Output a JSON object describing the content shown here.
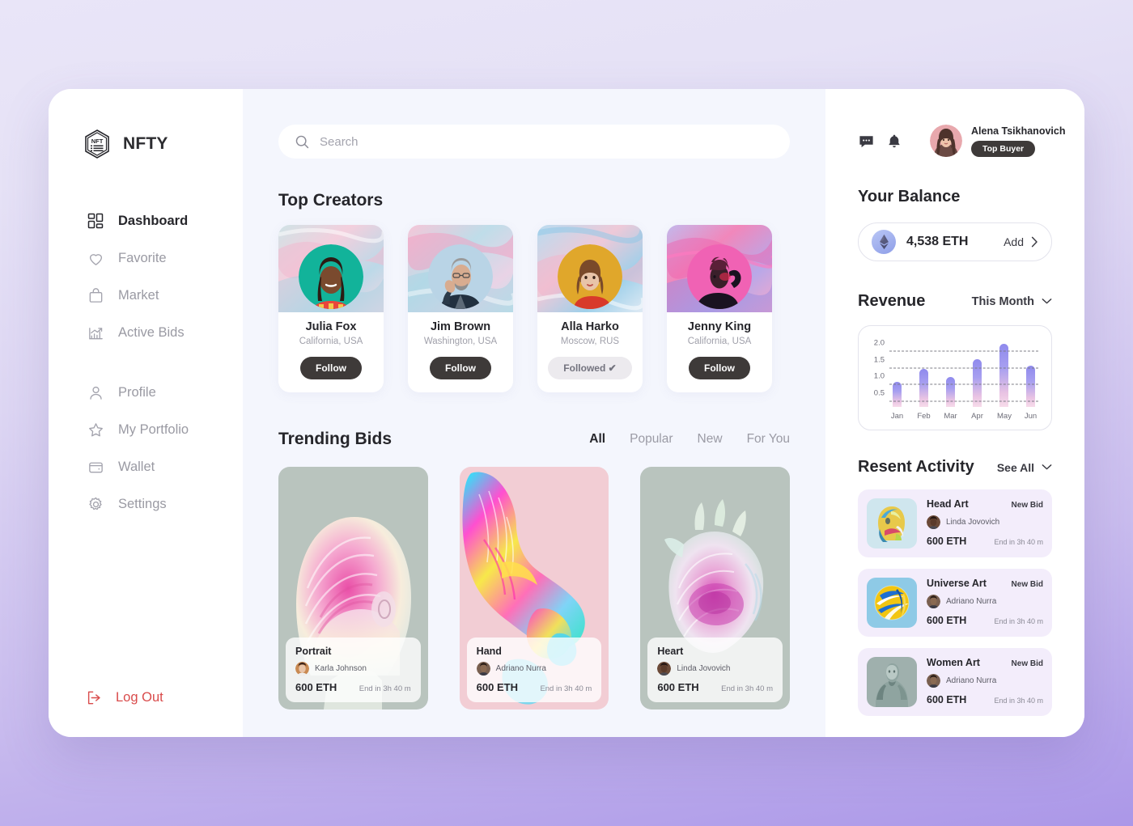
{
  "brand": {
    "name": "NFTY",
    "logo_icon": "nft-hexagon-logo-icon"
  },
  "sidebar": {
    "groups": [
      {
        "items": [
          {
            "label": "Dashboard",
            "icon": "grid-icon",
            "active": true
          },
          {
            "label": "Favorite",
            "icon": "heart-icon",
            "active": false
          },
          {
            "label": "Market",
            "icon": "bag-icon",
            "active": false
          },
          {
            "label": "Active Bids",
            "icon": "chart-up-icon",
            "active": false
          }
        ]
      },
      {
        "items": [
          {
            "label": "Profile",
            "icon": "user-icon",
            "active": false
          },
          {
            "label": "My Portfolio",
            "icon": "star-icon",
            "active": false
          },
          {
            "label": "Wallet",
            "icon": "wallet-icon",
            "active": false
          },
          {
            "label": "Settings",
            "icon": "gear-icon",
            "active": false
          }
        ]
      }
    ],
    "logout": {
      "label": "Log Out",
      "icon": "logout-arrow-icon",
      "color": "#d94b4b"
    }
  },
  "search": {
    "placeholder": "Search",
    "value": "",
    "icon": "search-icon"
  },
  "top_creators": {
    "title": "Top Creators",
    "cards": [
      {
        "name": "Julia Fox",
        "location": "California, USA",
        "button": "Follow",
        "followed": false,
        "cover": [
          "#cfe3e6",
          "#f3cfdd",
          "#bcd9e8",
          "#f0d7e4"
        ],
        "avatar": [
          "#12b39a",
          "#0ea58f"
        ],
        "skin": "#7a4a2e",
        "hair": "#2b1c14",
        "shirt": "#e8453c"
      },
      {
        "name": "Jim Brown",
        "location": "Washington, USA",
        "button": "Follow",
        "followed": false,
        "cover": [
          "#f5c6d8",
          "#bfdde9",
          "#e9d3e6",
          "#c9e2ea"
        ],
        "avatar": [
          "#b9d4e6",
          "#a5c7de"
        ],
        "skin": "#d8ac90",
        "hair": "#9a9a9a",
        "shirt": "#22303f"
      },
      {
        "name": "Alla Harko",
        "location": "Moscow, RUS",
        "button": "Followed",
        "followed": true,
        "cover": [
          "#b9dcf0",
          "#eec9d8",
          "#9fd0ea",
          "#dfeaf4"
        ],
        "avatar": [
          "#e0a72b",
          "#cf9520"
        ],
        "skin": "#e8c4a8",
        "hair": "#7a4a2a",
        "shirt": "#d83a2a"
      },
      {
        "name": "Jenny King",
        "location": "California, USA",
        "button": "Follow",
        "followed": false,
        "cover": [
          "#c3b8ec",
          "#f187bb",
          "#b9a8e8",
          "#f5a7cc"
        ],
        "avatar": [
          "#f062b4",
          "#e8479f"
        ],
        "skin": "#3a1f2a",
        "hair": "#5a2038",
        "shirt": "#1a1220"
      }
    ]
  },
  "trending": {
    "title": "Trending Bids",
    "tabs": [
      {
        "label": "All",
        "active": true
      },
      {
        "label": "Popular",
        "active": false
      },
      {
        "label": "New",
        "active": false
      },
      {
        "label": "For You",
        "active": false
      }
    ],
    "cards": [
      {
        "title": "Portrait",
        "owner": "Karla Johnson",
        "price": "600 ETH",
        "end": "End in 3h 40 m",
        "bg": "#b9c4be",
        "art": "portrait-sculpture-art",
        "c1": "#f5a8d0",
        "c2": "#ea4fa8",
        "c3": "#f7eddc",
        "ava1": "#c98a52",
        "ava2": "#3a2218"
      },
      {
        "title": "Hand",
        "owner": "Adriano Nurra",
        "price": "600 ETH",
        "end": "End in 3h 40 m",
        "bg": "#f2cdd4",
        "art": "hand-sculpture-art",
        "c1": "#ff4fd0",
        "c2": "#45d4f5",
        "c3": "#f7e84a",
        "ava1": "#7a6050",
        "ava2": "#2a1d16"
      },
      {
        "title": "Heart",
        "owner": "Linda Jovovich",
        "price": "600 ETH",
        "end": "End in 3h 40 m",
        "bg": "#b9c4be",
        "art": "heart-sculpture-art",
        "c1": "#d94fb8",
        "c2": "#cfe4d8",
        "c3": "#efe3f0",
        "ava1": "#6b4a38",
        "ava2": "#241612"
      }
    ]
  },
  "header": {
    "message_icon": "message-dots-icon",
    "notification_icon": "bell-icon",
    "user_name": "Alena Tsikhanovich",
    "user_badge": "Top Buyer"
  },
  "balance": {
    "title": "Your Balance",
    "amount": "4,538 ETH",
    "add_label": "Add",
    "coin_icon": "ethereum-icon",
    "chevron_icon": "chevron-right-icon"
  },
  "revenue": {
    "title": "Revenue",
    "selector": "This Month",
    "chevron_icon": "chevron-down-icon"
  },
  "chart_data": {
    "type": "bar",
    "title": "Revenue",
    "categories": [
      "Jan",
      "Feb",
      "Mar",
      "Apr",
      "May",
      "Jun"
    ],
    "values": [
      1.1,
      1.5,
      1.25,
      1.8,
      2.25,
      1.6
    ],
    "yticks": [
      0.5,
      1.0,
      1.5,
      2.0
    ],
    "ytick_labels": [
      "0.5",
      "1.0",
      "1.5",
      "2.0"
    ],
    "ylim": [
      0.35,
      2.45
    ],
    "xlabel": "",
    "ylabel": "",
    "grid": true,
    "grid_style": "dashed-horizontal",
    "legend": "none",
    "bar_gradient_top": "#8f8aed",
    "bar_gradient_bottom": "#f7dcea"
  },
  "activity": {
    "title": "Resent Activity",
    "see_all": "See All",
    "chevron_icon": "chevron-down-icon",
    "items": [
      {
        "title": "Head Art",
        "tag": "New Bid",
        "owner": "Linda Jovovich",
        "price": "600 ETH",
        "end": "End in 3h 40 m",
        "thumb_bg": "#cfe6ee",
        "thumb_art": "head-art-thumb",
        "c1": "#e8c94a",
        "c2": "#4aa8d8",
        "c3": "#d84a6a",
        "ava1": "#6b4a38",
        "ava2": "#241612"
      },
      {
        "title": "Universe Art",
        "tag": "New Bid",
        "owner": "Adriano Nurra",
        "price": "600 ETH",
        "end": "End in 3h 40 m",
        "thumb_bg": "#8ecae6",
        "thumb_art": "universe-art-thumb",
        "c1": "#f2c511",
        "c2": "#1f6fd0",
        "c3": "#ffffff",
        "ava1": "#7a6050",
        "ava2": "#2a1d16"
      },
      {
        "title": "Women Art",
        "tag": "New Bid",
        "owner": "Adriano Nurra",
        "price": "600 ETH",
        "end": "End in 3h 40 m",
        "thumb_bg": "#9fb0ad",
        "thumb_art": "women-art-thumb",
        "c1": "#8fa4a0",
        "c2": "#6d8480",
        "c3": "#b9c9c5",
        "ava1": "#7a6050",
        "ava2": "#2a1d16"
      }
    ]
  }
}
